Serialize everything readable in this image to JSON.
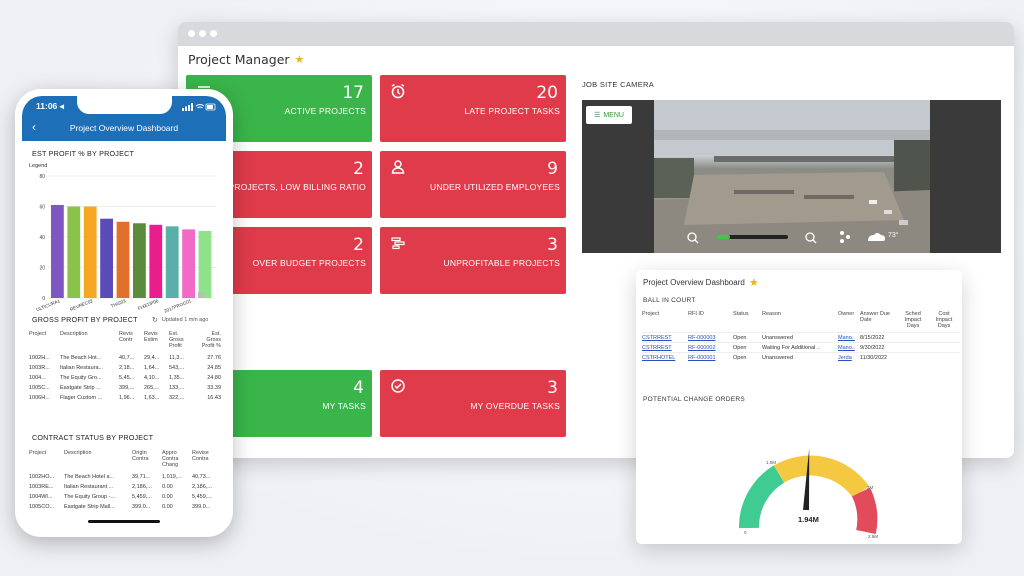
{
  "window": {
    "title": "Project Manager",
    "star": "★"
  },
  "tiles": [
    {
      "value": "17",
      "label": "ACTIVE PROJECTS",
      "color": "#3ab54a"
    },
    {
      "value": "20",
      "label": "LATE PROJECT TASKS",
      "color": "#df3b4a"
    },
    {
      "value": "2",
      "label": "PROJECTS, LOW BILLING RATIO",
      "color": "#df3b4a"
    },
    {
      "value": "9",
      "label": "UNDER UTILIZED EMPLOYEES",
      "color": "#df3b4a"
    },
    {
      "value": "2",
      "label": "OVER BUDGET PROJECTS",
      "color": "#df3b4a"
    },
    {
      "value": "3",
      "label": "UNPROFITABLE PROJECTS",
      "color": "#df3b4a"
    },
    {
      "value": "4",
      "label": "MY TASKS",
      "color": "#3ab54a"
    },
    {
      "value": "3",
      "label": "MY OVERDUE TASKS",
      "color": "#df3b4a"
    }
  ],
  "camera": {
    "label": "JOB SITE CAMERA",
    "menu": "MENU",
    "temp": "73°"
  },
  "card": {
    "title": "Project Overview Dashboard",
    "ball_in_court": "BALL IN COURT",
    "columns": [
      "Project",
      "RFI ID",
      "Status",
      "Reason",
      "Owner",
      "Answer Due Date",
      "Sched Impact Days",
      "Cost Impact Days"
    ],
    "rows": [
      [
        "CSTRREST",
        "RF-000003",
        "Open",
        "Unanswered",
        "Mano..",
        "8/15/2022",
        "",
        ""
      ],
      [
        "CSTRREST",
        "RF-000002",
        "Open",
        "Waiting For Additional ..",
        "Mano..",
        "9/30/2022",
        "",
        ""
      ],
      [
        "CSTRHOTEL",
        "RF-000001",
        "Open",
        "Unanswered",
        "Jerda",
        "11/30/2022",
        "",
        ""
      ]
    ],
    "change_orders": "POTENTIAL CHANGE ORDERS",
    "gauge": {
      "value": "1.94M",
      "ticks": [
        "0",
        "1.0M",
        "1.9M",
        "2M",
        "2.6M"
      ],
      "value_frac": 0.75
    }
  },
  "phone": {
    "time": "11:06 ◂",
    "header": "Project Overview Dashboard",
    "chart_title": "EST PROFIT % BY PROJECT",
    "legend": "Legend",
    "chart_data": {
      "type": "bar",
      "title": "EST PROFIT % BY PROJECT",
      "categories": [
        "ULTICURA1",
        "",
        "REVREC02",
        "",
        "THIS03",
        "",
        "FIXEDP06",
        "",
        "2017PROG01",
        ""
      ],
      "values": [
        61,
        60,
        60,
        52,
        50,
        49,
        48,
        47,
        45,
        44
      ],
      "colors": [
        "#7e57c2",
        "#8bc34a",
        "#f5a623",
        "#5b4bb7",
        "#e0712b",
        "#5b8a3c",
        "#e91e8c",
        "#5ab0a8",
        "#f06ac6",
        "#90e28a"
      ],
      "yticks": [
        "0",
        "20",
        "40",
        "60",
        "80"
      ],
      "ylim": [
        0,
        80
      ]
    },
    "gross_title": "GROSS PROFIT BY PROJECT",
    "updated": "Updated 1 min ago",
    "gross_cols": [
      "Project",
      "Description",
      "Revis Contr",
      "Revis Estim",
      "Est. Gross Profit",
      "Est. Gross Profit %"
    ],
    "gross_rows": [
      [
        "1002H...",
        "The Beach Hot...",
        "40,7...",
        "29,4...",
        "11,3...",
        "27.76"
      ],
      [
        "1003R...",
        "Italian Restaura...",
        "2,18...",
        "1,64...",
        "543,...",
        "24.85"
      ],
      [
        "1004...",
        "The Equity Gro...",
        "5,45...",
        "4,10...",
        "1,35...",
        "24.80"
      ],
      [
        "1005C...",
        "Eastgate Strip ...",
        "399,...",
        "265,...",
        "133,...",
        "33.39"
      ],
      [
        "1006H...",
        "Flager Custom ...",
        "1,96...",
        "1,63...",
        "322,...",
        "16.43"
      ]
    ],
    "contract_title": "CONTRACT STATUS BY PROJECT",
    "contract_cols": [
      "Project",
      "Description",
      "Origin Contra",
      "Appro Contra Chang",
      "Revise Contra"
    ],
    "contract_rows": [
      [
        "1002HO...",
        "The Beach Hotel a...",
        "39,71...",
        "1,019,...",
        "40,73..."
      ],
      [
        "1003RE...",
        "Italian Restaurant ...",
        "2,186,...",
        "0.00",
        "2,186,..."
      ],
      [
        "1004WI...",
        "The Equity Group -...",
        "5,459,...",
        "0.00",
        "5,459,..."
      ],
      [
        "1005CO...",
        "Eastgate Strip Mall...",
        "399.0...",
        "0.00",
        "399.0..."
      ]
    ]
  }
}
